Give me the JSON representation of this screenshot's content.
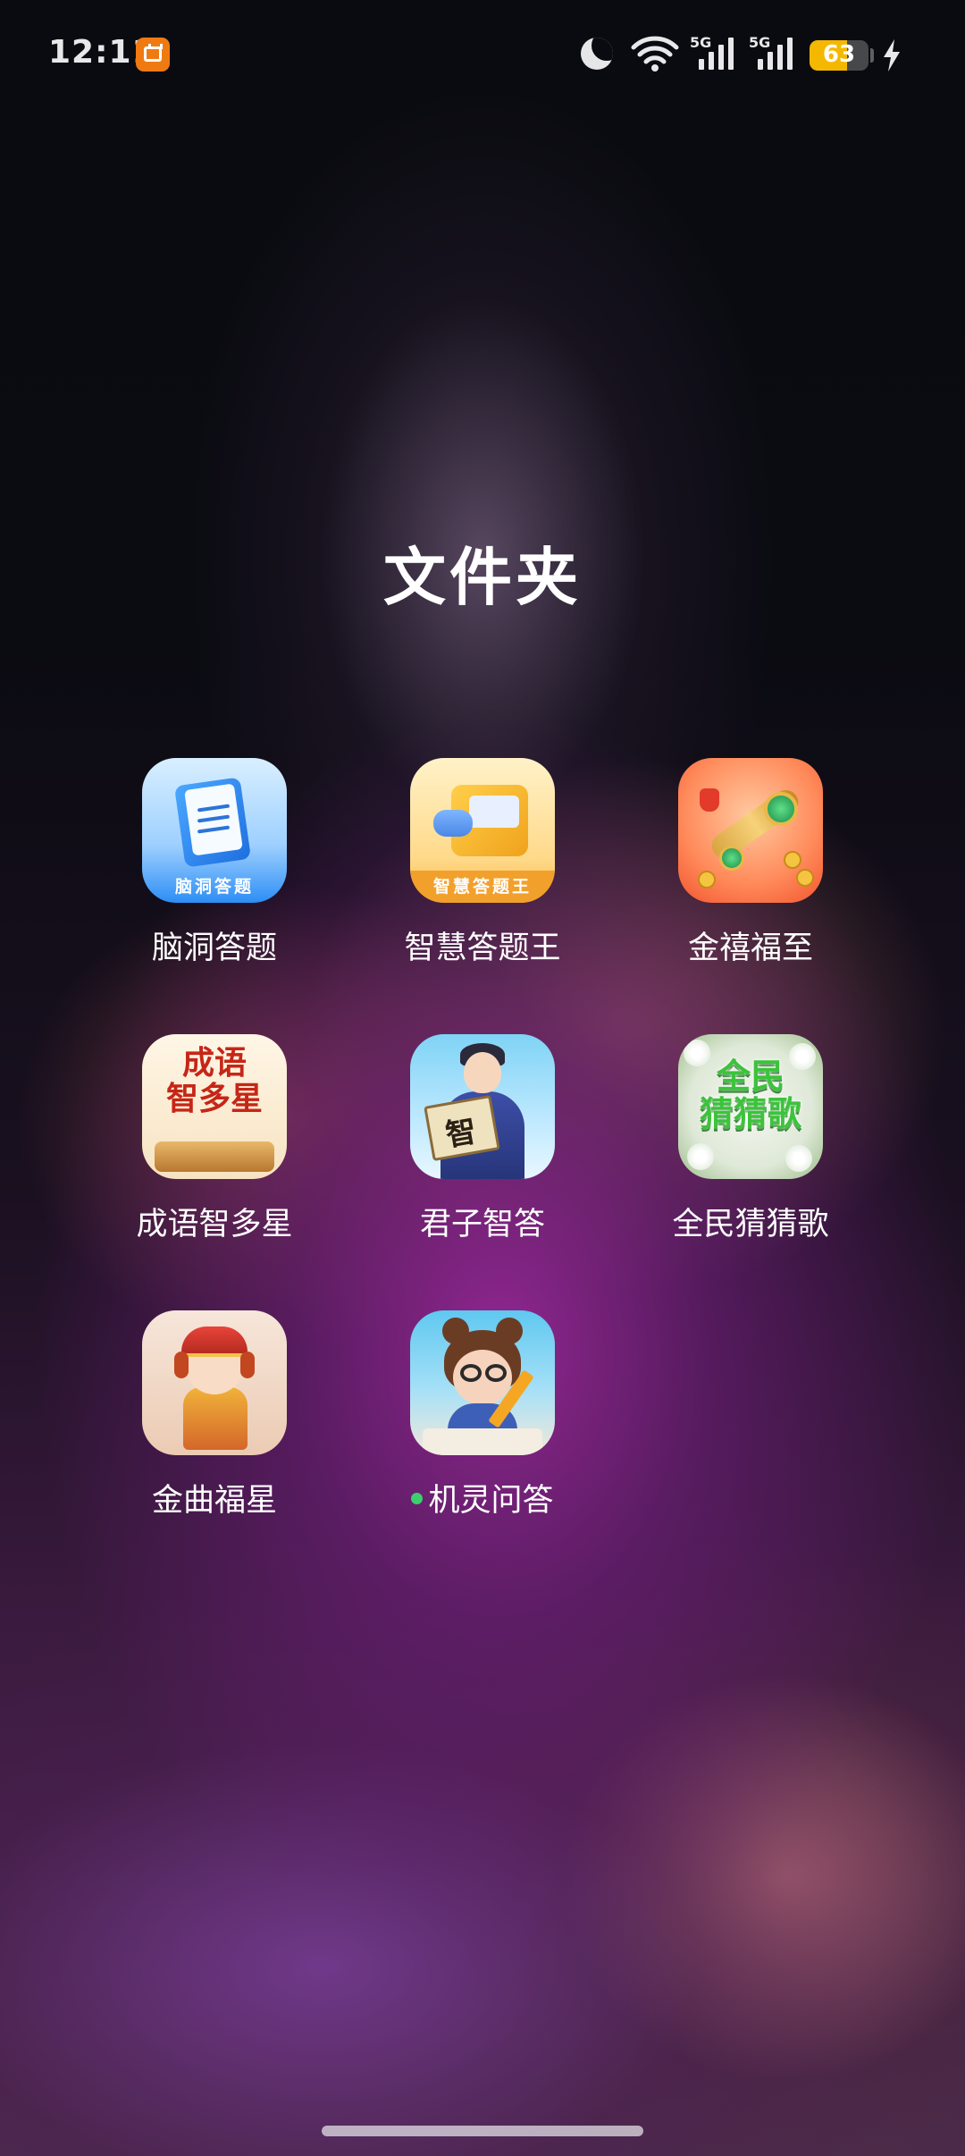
{
  "status_bar": {
    "time": "12:11",
    "network_type_1": "5G",
    "network_type_2": "5G",
    "battery_percent": "63",
    "battery_level": 0.63,
    "charging": true,
    "icons": [
      "calendar-notification-icon",
      "moon-icon",
      "wifi-icon",
      "signal-icon",
      "signal-icon",
      "battery-icon",
      "charging-bolt-icon"
    ]
  },
  "folder": {
    "title": "文件夹",
    "apps": [
      {
        "label": "脑洞答题",
        "icon_text": "脑洞答题",
        "new": false
      },
      {
        "label": "智慧答题王",
        "icon_text": "智慧答题王",
        "new": false
      },
      {
        "label": "金禧福至",
        "new": false
      },
      {
        "label": "成语智多星",
        "icon_text_line1": "成语",
        "icon_text_line2": "智多星",
        "new": false
      },
      {
        "label": "君子智答",
        "icon_text": "智",
        "new": false
      },
      {
        "label": "全民猜猜歌",
        "icon_text_line1": "全民",
        "icon_text_line2": "猜猜歌",
        "new": false
      },
      {
        "label": "金曲福星",
        "new": false
      },
      {
        "label": "机灵问答",
        "new": true
      }
    ]
  },
  "colors": {
    "accent_orange": "#f07a12",
    "battery_yellow": "#f5b800",
    "new_dot_green": "#3ccf6e"
  }
}
